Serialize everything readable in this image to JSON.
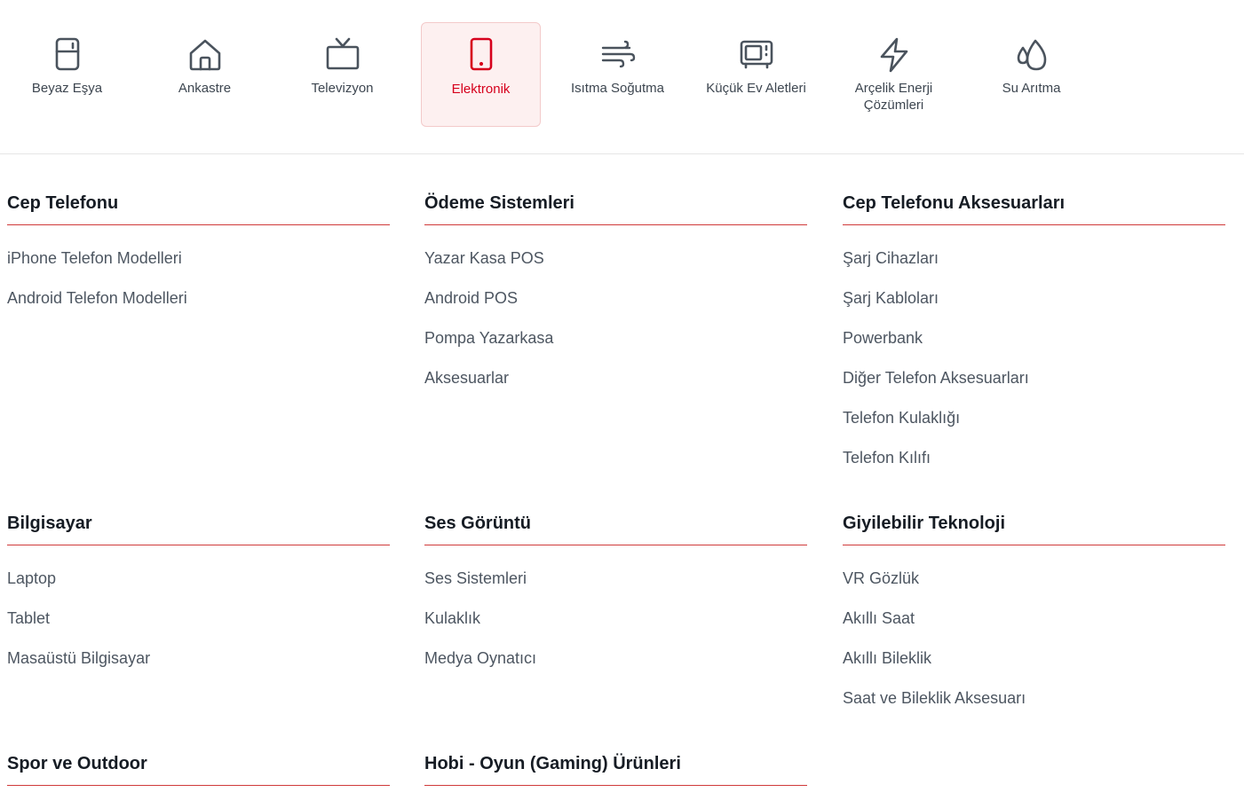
{
  "categories": [
    {
      "label": "Beyaz Eşya",
      "icon": "fridge-icon",
      "active": false
    },
    {
      "label": "Ankastre",
      "icon": "home-icon",
      "active": false
    },
    {
      "label": "Televizyon",
      "icon": "tv-icon",
      "active": false
    },
    {
      "label": "Elektronik",
      "icon": "smartphone-icon",
      "active": true
    },
    {
      "label": "Isıtma Soğutma",
      "icon": "wind-icon",
      "active": false
    },
    {
      "label": "Küçük Ev Aletleri",
      "icon": "microwave-icon",
      "active": false
    },
    {
      "label": "Arçelik Enerji Çözümleri",
      "icon": "lightning-icon",
      "active": false
    },
    {
      "label": "Su Arıtma",
      "icon": "water-drops-icon",
      "active": false
    }
  ],
  "colors": {
    "accent": "#d6001c",
    "active_bg": "#fdf0f0",
    "divider": "#d03a3a",
    "icon": "#4a535d"
  },
  "sections": [
    {
      "title": "Cep Telefonu",
      "items": [
        "iPhone Telefon Modelleri",
        "Android Telefon Modelleri"
      ]
    },
    {
      "title": "Ödeme Sistemleri",
      "items": [
        "Yazar Kasa POS",
        "Android POS",
        "Pompa Yazarkasa",
        "Aksesuarlar"
      ]
    },
    {
      "title": "Cep Telefonu Aksesuarları",
      "items": [
        "Şarj Cihazları",
        "Şarj Kabloları",
        "Powerbank",
        "Diğer Telefon Aksesuarları",
        "Telefon Kulaklığı",
        "Telefon Kılıfı"
      ]
    },
    {
      "title": "Bilgisayar",
      "items": [
        "Laptop",
        "Tablet",
        "Masaüstü Bilgisayar"
      ]
    },
    {
      "title": "Ses Görüntü",
      "items": [
        "Ses Sistemleri",
        "Kulaklık",
        "Medya Oynatıcı"
      ]
    },
    {
      "title": "Giyilebilir Teknoloji",
      "items": [
        "VR Gözlük",
        "Akıllı Saat",
        "Akıllı Bileklik",
        "Saat ve Bileklik Aksesuarı"
      ]
    },
    {
      "title": "Spor ve Outdoor",
      "items": []
    },
    {
      "title": "Hobi - Oyun (Gaming) Ürünleri",
      "items": []
    }
  ]
}
